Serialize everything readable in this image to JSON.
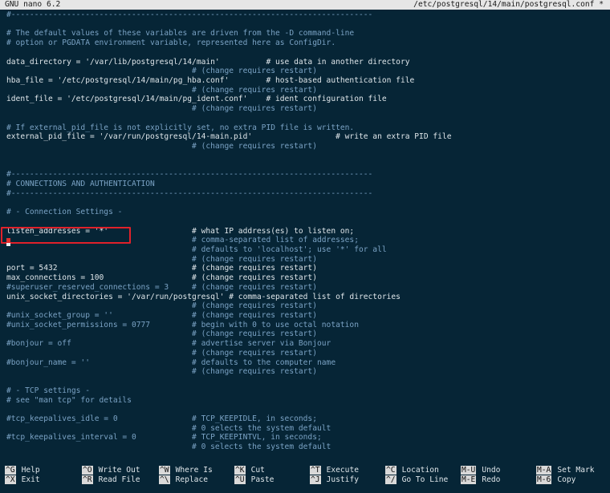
{
  "titlebar": {
    "app": "GNU nano 6.2",
    "file": "/etc/postgresql/14/main/postgresql.conf *"
  },
  "lines": [
    {
      "text": "#------------------------------------------------------------------------------",
      "kind": "c"
    },
    {
      "text": "",
      "kind": "n"
    },
    {
      "text": "# The default values of these variables are driven from the -D command-line",
      "kind": "c"
    },
    {
      "text": "# option or PGDATA environment variable, represented here as ConfigDir.",
      "kind": "c"
    },
    {
      "text": "",
      "kind": "n"
    },
    {
      "text": "data_directory = '/var/lib/postgresql/14/main'          # use data in another directory",
      "kind": "n"
    },
    {
      "text": "                                        # (change requires restart)",
      "kind": "c"
    },
    {
      "text": "hba_file = '/etc/postgresql/14/main/pg_hba.conf'        # host-based authentication file",
      "kind": "n"
    },
    {
      "text": "                                        # (change requires restart)",
      "kind": "c"
    },
    {
      "text": "ident_file = '/etc/postgresql/14/main/pg_ident.conf'    # ident configuration file",
      "kind": "n"
    },
    {
      "text": "                                        # (change requires restart)",
      "kind": "c"
    },
    {
      "text": "",
      "kind": "n"
    },
    {
      "text": "# If external_pid_file is not explicitly set, no extra PID file is written.",
      "kind": "c"
    },
    {
      "text": "external_pid_file = '/var/run/postgresql/14-main.pid'                  # write an extra PID file",
      "kind": "n"
    },
    {
      "text": "                                        # (change requires restart)",
      "kind": "c"
    },
    {
      "text": "",
      "kind": "n"
    },
    {
      "text": "",
      "kind": "n"
    },
    {
      "text": "#------------------------------------------------------------------------------",
      "kind": "c"
    },
    {
      "text": "# CONNECTIONS AND AUTHENTICATION",
      "kind": "c"
    },
    {
      "text": "#------------------------------------------------------------------------------",
      "kind": "c"
    },
    {
      "text": "",
      "kind": "n"
    },
    {
      "text": "# - Connection Settings -",
      "kind": "c"
    },
    {
      "text": "",
      "kind": "n"
    },
    {
      "text": "listen_addresses = '*'                  # what IP address(es) to listen on;",
      "kind": "n"
    },
    {
      "text": "                                        # comma-separated list of addresses;",
      "kind": "c"
    },
    {
      "text": "                                        # defaults to 'localhost'; use '*' for all",
      "kind": "c"
    },
    {
      "text": "                                        # (change requires restart)",
      "kind": "c"
    },
    {
      "text": "port = 5432                             # (change requires restart)",
      "kind": "n"
    },
    {
      "text": "max_connections = 100                   # (change requires restart)",
      "kind": "n"
    },
    {
      "text": "#superuser_reserved_connections = 3     # (change requires restart)",
      "kind": "c"
    },
    {
      "text": "unix_socket_directories = '/var/run/postgresql' # comma-separated list of directories",
      "kind": "n"
    },
    {
      "text": "                                        # (change requires restart)",
      "kind": "c"
    },
    {
      "text": "#unix_socket_group = ''                 # (change requires restart)",
      "kind": "c"
    },
    {
      "text": "#unix_socket_permissions = 0777         # begin with 0 to use octal notation",
      "kind": "c"
    },
    {
      "text": "                                        # (change requires restart)",
      "kind": "c"
    },
    {
      "text": "#bonjour = off                          # advertise server via Bonjour",
      "kind": "c"
    },
    {
      "text": "                                        # (change requires restart)",
      "kind": "c"
    },
    {
      "text": "#bonjour_name = ''                      # defaults to the computer name",
      "kind": "c"
    },
    {
      "text": "                                        # (change requires restart)",
      "kind": "c"
    },
    {
      "text": "",
      "kind": "n"
    },
    {
      "text": "# - TCP settings -",
      "kind": "c"
    },
    {
      "text": "# see \"man tcp\" for details",
      "kind": "c"
    },
    {
      "text": "",
      "kind": "n"
    },
    {
      "text": "#tcp_keepalives_idle = 0                # TCP_KEEPIDLE, in seconds;",
      "kind": "c"
    },
    {
      "text": "                                        # 0 selects the system default",
      "kind": "c"
    },
    {
      "text": "#tcp_keepalives_interval = 0            # TCP_KEEPINTVL, in seconds;",
      "kind": "c"
    },
    {
      "text": "                                        # 0 selects the system default",
      "kind": "c"
    }
  ],
  "shortcuts": [
    {
      "key": "^G",
      "label": "Help",
      "name": "help"
    },
    {
      "key": "^O",
      "label": "Write Out",
      "name": "write-out"
    },
    {
      "key": "^W",
      "label": "Where Is",
      "name": "where-is"
    },
    {
      "key": "^K",
      "label": "Cut",
      "name": "cut"
    },
    {
      "key": "^T",
      "label": "Execute",
      "name": "execute"
    },
    {
      "key": "^C",
      "label": "Location",
      "name": "location"
    },
    {
      "key": "M-U",
      "label": "Undo",
      "name": "undo"
    },
    {
      "key": "M-A",
      "label": "Set Mark",
      "name": "set-mark"
    },
    {
      "key": "^X",
      "label": "Exit",
      "name": "exit"
    },
    {
      "key": "^R",
      "label": "Read File",
      "name": "read-file"
    },
    {
      "key": "^\\",
      "label": "Replace",
      "name": "replace"
    },
    {
      "key": "^U",
      "label": "Paste",
      "name": "paste"
    },
    {
      "key": "^J",
      "label": "Justify",
      "name": "justify"
    },
    {
      "key": "^/",
      "label": "Go To Line",
      "name": "go-to-line"
    },
    {
      "key": "M-E",
      "label": "Redo",
      "name": "redo"
    },
    {
      "key": "M-6",
      "label": "Copy",
      "name": "copy"
    }
  ],
  "colors": {
    "background": "#062536",
    "comment": "#7aa2c4",
    "text": "#dfe6ea",
    "highlight_box": "#e0212a",
    "titlebar": "#e6e6e6"
  }
}
